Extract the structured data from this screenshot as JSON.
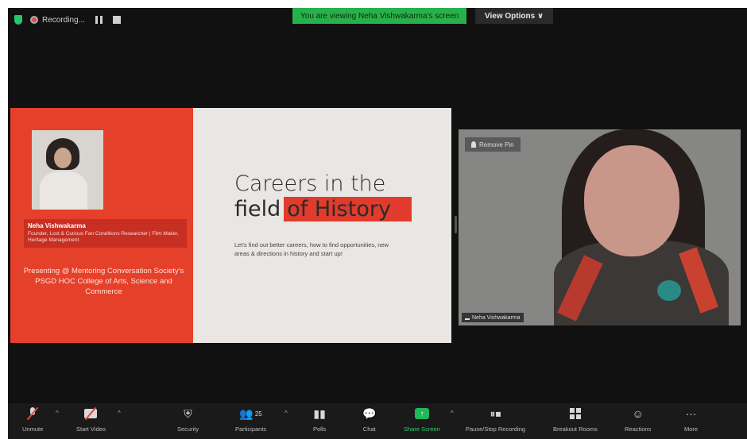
{
  "topbar": {
    "recording_label": "Recording...",
    "viewing_banner": "You are viewing Neha Vishwakarma's screen",
    "view_options": "View Options ∨"
  },
  "slide": {
    "speaker_name": "Neha Vishwakarma",
    "speaker_role": "Founder, Lost & Curious Fan Conditions Researcher | Film Maker, Heritage Management",
    "presenting": "Presenting @ Mentoring Conversation Society's PSGD HOC College of Arts, Science and Commerce",
    "title_line1": "Careers in the",
    "title_line2_plain": "field",
    "title_line2_highlight": "of History",
    "body": "Let's find out better careers, how to find opportunities, new areas & directions in history and start up!"
  },
  "video": {
    "remove_pin": "Remove Pin",
    "participant_name": "Neha Vishwakarma"
  },
  "toolbar": {
    "items": [
      {
        "label": "Unmute",
        "icon": "muted-mic-icon"
      },
      {
        "label": "Start Video",
        "icon": "video-off-icon"
      },
      {
        "label": "Security",
        "icon": "shield-icon"
      },
      {
        "label": "Participants",
        "icon": "participants-icon",
        "count": "25"
      },
      {
        "label": "Polls",
        "icon": "polls-icon"
      },
      {
        "label": "Chat",
        "icon": "chat-icon"
      },
      {
        "label": "Share Screen",
        "icon": "share-screen-icon"
      },
      {
        "label": "Pause/Stop Recording",
        "icon": "recording-icon"
      },
      {
        "label": "Breakout Rooms",
        "icon": "breakout-icon"
      },
      {
        "label": "Reactions",
        "icon": "reactions-icon"
      },
      {
        "label": "More",
        "icon": "more-icon"
      }
    ]
  },
  "colors": {
    "share_green": "#1fb85a",
    "slide_red": "#e5402a",
    "muted_red": "#e0483d"
  }
}
